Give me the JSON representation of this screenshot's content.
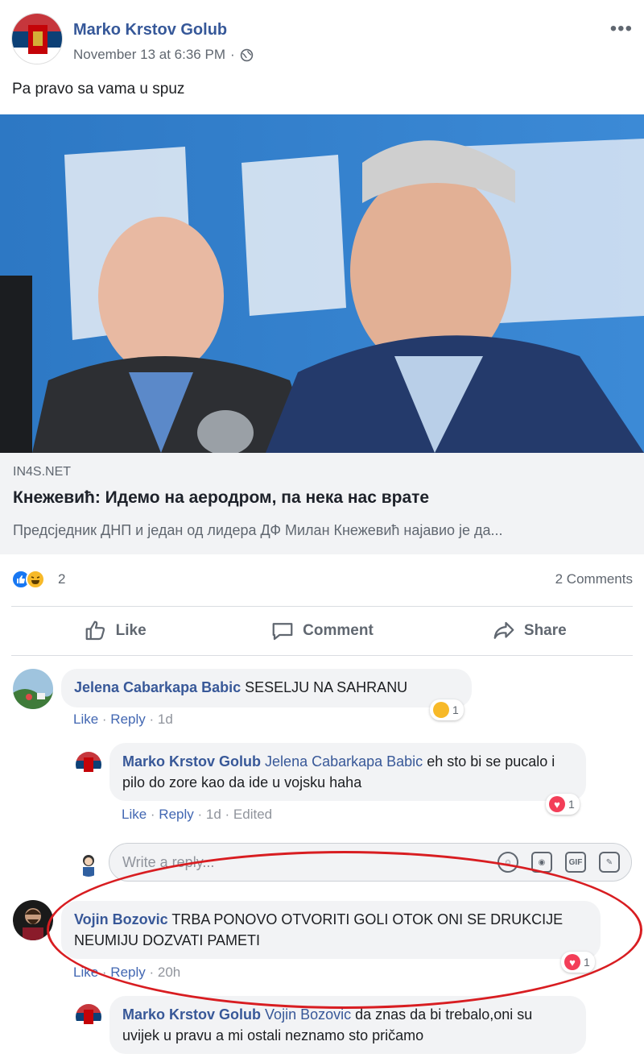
{
  "post": {
    "author": "Marko Krstov Golub",
    "timestamp": "November 13 at 6:36 PM",
    "separator": "·",
    "text": "Pa pravo sa vama u spuz"
  },
  "link": {
    "domain": "IN4S.NET",
    "title": "Кнежевић: Идемо на аеродром, па нека нас врате",
    "description": "Предсједник ДНП и један од лидера ДФ Милан Кнежевић најавио је да..."
  },
  "reactions": {
    "count": "2",
    "comments": "2 Comments",
    "icons": [
      "like-icon",
      "haha-icon"
    ]
  },
  "actions": {
    "like": "Like",
    "comment": "Comment",
    "share": "Share"
  },
  "comments": [
    {
      "author": "Jelena Cabarkapa Babic",
      "text": "SESELJU NA SAHRANU",
      "like": "Like",
      "reply": "Reply",
      "time": "1d",
      "reaction_count": "1"
    },
    {
      "author": "Marko Krstov Golub",
      "mention": "Jelena Cabarkapa Babic",
      "text": "eh sto bi se pucalo i pilo do zore kao da ide u vojsku haha",
      "like": "Like",
      "reply": "Reply",
      "time": "1d",
      "edited": "Edited",
      "reaction_count": "1"
    },
    {
      "author": "Vojin Bozovic",
      "text": "TRBA PONOVO OTVORITI GOLI OTOK ONI SE DRUKCIJE NEUMIJU DOZVATI PAMETI",
      "like": "Like",
      "reply": "Reply",
      "time": "20h",
      "reaction_count": "1"
    },
    {
      "author": "Marko Krstov Golub",
      "mention": "Vojin Bozovic",
      "text": "da znas da bi trebalo,oni su uvijek u pravu a mi ostali neznamo sto pričamo"
    }
  ],
  "reply_box": {
    "placeholder": "Write a reply...",
    "gif": "GIF"
  },
  "colors": {
    "link_blue": "#385898",
    "annotation_red": "#d81d21"
  }
}
